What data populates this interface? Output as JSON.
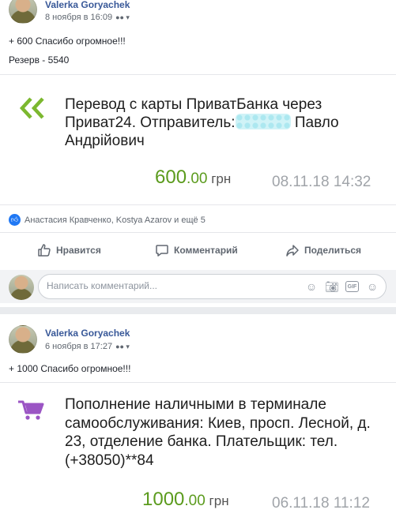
{
  "post1": {
    "author": "Valerka Goryachek",
    "timestamp": "8 ноября в 16:09",
    "text_line1": "+ 600 Спасибо огромное!!!",
    "text_line2": "Резерв - 5540",
    "card": {
      "icon": "double-chevron-left-icon",
      "title_part1": "Перевод с карты ПриватБанка через Приват24. Отправитель:",
      "title_part2": " Павло Андрійович",
      "amount_int": "600",
      "amount_dec": ".00",
      "currency": " грн",
      "date": "08.11.18 14:32"
    },
    "reactions": "Анастасия Кравченко, Kostya Azarov и ещё 5",
    "actions": {
      "like": "Нравится",
      "comment": "Комментарий",
      "share": "Поделиться"
    },
    "comment_placeholder": "Написать комментарий..."
  },
  "post2": {
    "author": "Valerka Goryachek",
    "timestamp": "6 ноября в 17:27",
    "text_line1": "+ 1000 Спасибо огромное!!!",
    "card": {
      "icon": "shopping-cart-icon",
      "title": "Пополнение наличными в терминале самообслуживания: Киев, просп. Лесной, д. 23, отделение банка. Плательщик: тел. (+38050)**84",
      "amount_int": "1000",
      "amount_dec": ".00",
      "currency": " грн",
      "date": "06.11.18 11:12"
    }
  },
  "colors": {
    "link": "#385898",
    "amount_green": "#5b9b1d",
    "icon_green": "#7cb82f",
    "cart_purple": "#9b55c4",
    "date_gray": "#a0a4a9",
    "like_blue": "#2078f4"
  }
}
